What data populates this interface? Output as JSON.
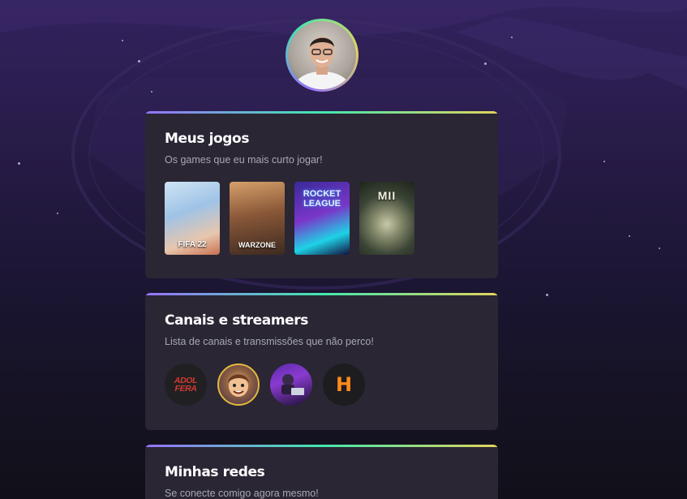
{
  "profile": {
    "avatar_alt": "Foto de perfil"
  },
  "games_section": {
    "title": "Meus jogos",
    "subtitle": "Os games que eu mais curto jogar!",
    "games": [
      {
        "name": "FIFA 22",
        "label": "FIFA 22"
      },
      {
        "name": "Call of Duty Warzone",
        "label": "WARZONE"
      },
      {
        "name": "Rocket League",
        "label": "ROCKET LEAGUE"
      },
      {
        "name": "Call of Duty Modern Warfare II",
        "label": "MII"
      }
    ]
  },
  "streamers_section": {
    "title": "Canais e streamers",
    "subtitle": "Lista de canais e transmissões que não perco!",
    "streamers": [
      {
        "label": "ADOL FERA"
      },
      {
        "label": ""
      },
      {
        "label": ""
      },
      {
        "label": "H"
      }
    ]
  },
  "social_section": {
    "title": "Minhas redes",
    "subtitle": "Se conecte comigo agora mesmo!"
  },
  "colors": {
    "accent_gradient": [
      "#9572fc",
      "#43e7ad",
      "#e2d45c"
    ],
    "card_bg": "#2a2634"
  },
  "icons": {
    "background_logo": "gaming-logo-watermark-icon"
  }
}
